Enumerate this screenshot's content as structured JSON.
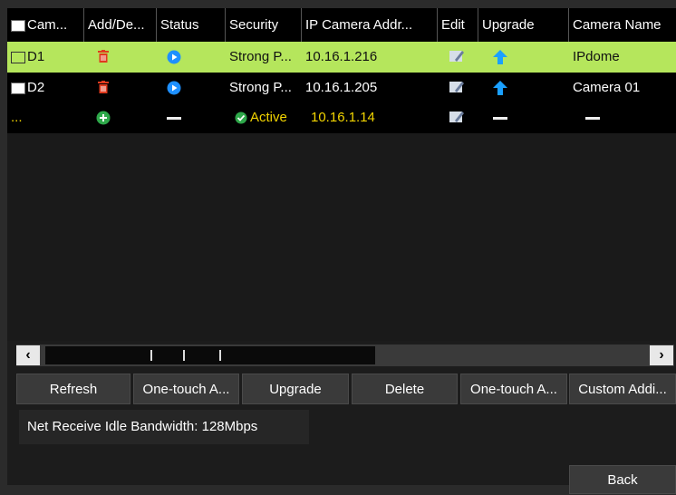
{
  "header": {
    "columns": [
      "Cam...",
      "Add/De...",
      "Status",
      "Security",
      "IP Camera Addr...",
      "Edit",
      "Upgrade",
      "Camera Name"
    ]
  },
  "rows": [
    {
      "camera": "D1",
      "security": "Strong P...",
      "ip": "10.16.1.216",
      "name": "IPdome",
      "selected": true
    },
    {
      "camera": "D2",
      "security": "Strong P...",
      "ip": "10.16.1.205",
      "name": "Camera 01",
      "selected": false
    },
    {
      "camera": "...",
      "security": "Active",
      "ip": "10.16.1.14",
      "name": "–",
      "pending": true
    }
  ],
  "buttons": {
    "refresh": "Refresh",
    "one_touch_activate": "One-touch A...",
    "upgrade": "Upgrade",
    "delete": "Delete",
    "one_touch_adding": "One-touch A...",
    "custom_adding": "Custom Addi...",
    "back": "Back"
  },
  "scroll": {
    "left": "‹",
    "right": "›"
  },
  "bandwidth": "Net Receive Idle Bandwidth: 128Mbps",
  "colors": {
    "selected_row": "#b5e65c",
    "pending_text": "#f2d400",
    "status_blue": "#1e90ff",
    "delete_red": "#e03a1e",
    "add_green": "#2ea84a"
  },
  "icons": [
    "checkbox",
    "trash-icon",
    "status-play-icon",
    "edit-icon",
    "upgrade-arrow-icon",
    "add-plus-icon",
    "check-icon"
  ]
}
